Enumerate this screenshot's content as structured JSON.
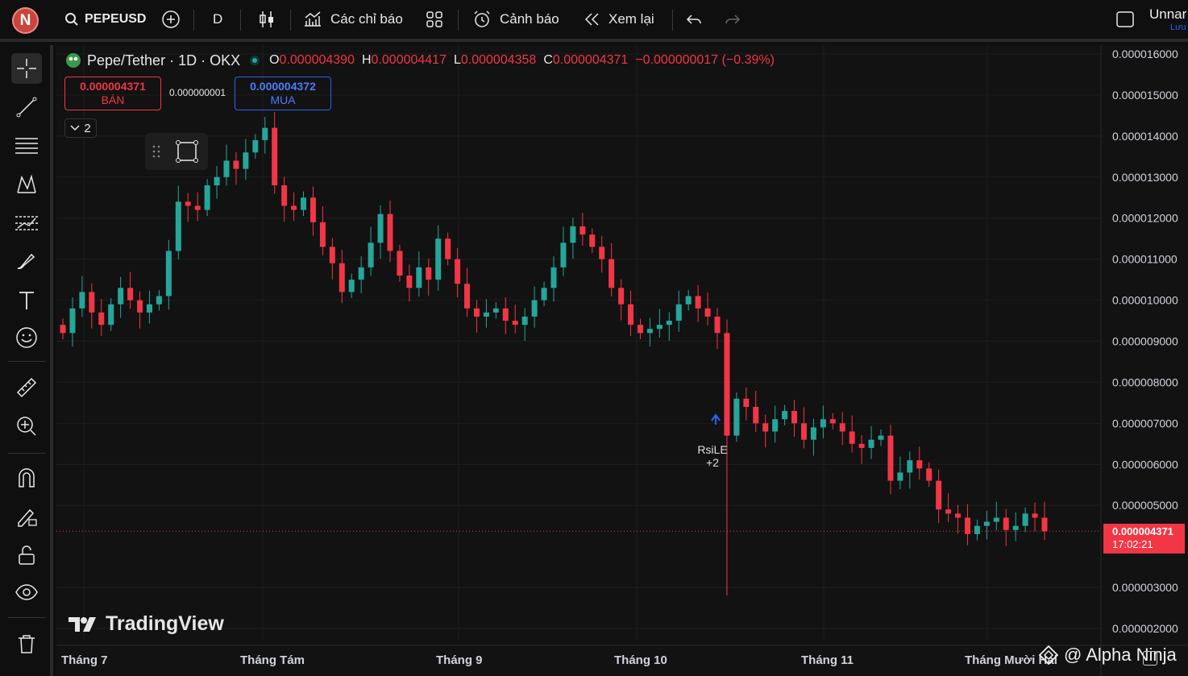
{
  "topbar": {
    "avatar_letter": "N",
    "symbol": "PEPEUSD",
    "interval": "D",
    "indicators_label": "Các chỉ báo",
    "alerts_label": "Cảnh báo",
    "replay_label": "Xem lại",
    "layout_name": "Unnar",
    "save_label": "Lưu"
  },
  "legend": {
    "title": "Pepe/Tether · 1D · OKX",
    "o_label": "O",
    "o_value": "0.000004390",
    "h_label": "H",
    "h_value": "0.000004417",
    "l_label": "L",
    "l_value": "0.000004358",
    "c_label": "C",
    "c_value": "0.000004371",
    "change": "−0.000000017 (−0.39%)",
    "sell_price": "0.000004371",
    "sell_label": "BÁN",
    "spread": "0.000000001",
    "buy_price": "0.000004372",
    "buy_label": "MUA",
    "collapse_count": "2"
  },
  "marker": {
    "label": "RsiLE",
    "extra": "+2"
  },
  "price_tag": {
    "price": "0.000004371",
    "countdown": "17:02:21"
  },
  "watermark": "TradingView",
  "credit": "@ Alpha Ninja",
  "colors": {
    "up": "#26a69a",
    "down": "#f23645",
    "bg": "#121212",
    "grid": "#1e1e1e",
    "buy": "#2962ff"
  },
  "chart_data": {
    "type": "candlestick",
    "y_ticks": [
      "0.000016000",
      "0.000015000",
      "0.000014000",
      "0.000013000",
      "0.000012000",
      "0.000011000",
      "0.000010000",
      "0.000009000",
      "0.000008000",
      "0.000007000",
      "0.000006000",
      "0.000005000",
      "0.000003000",
      "0.000002000"
    ],
    "x_ticks": [
      "Tháng 7",
      "Tháng Tám",
      "Tháng 9",
      "Tháng 10",
      "Tháng 11",
      "Tháng Mười Hai"
    ],
    "ylim": [
      2e-06,
      1.6e-05
    ],
    "closes_approx": [
      9.2,
      9.8,
      10.2,
      9.7,
      9.4,
      9.9,
      10.3,
      10.0,
      9.7,
      9.9,
      10.1,
      11.2,
      12.4,
      12.3,
      12.2,
      12.8,
      13.0,
      13.4,
      13.2,
      13.6,
      13.9,
      14.2,
      12.8,
      12.3,
      12.2,
      12.5,
      11.9,
      11.3,
      10.9,
      10.2,
      10.5,
      10.8,
      11.4,
      12.1,
      11.2,
      10.6,
      10.3,
      10.8,
      10.5,
      11.5,
      11.0,
      10.4,
      9.8,
      9.6,
      9.7,
      9.8,
      9.5,
      9.4,
      9.6,
      10.0,
      10.3,
      10.8,
      11.4,
      11.8,
      11.6,
      11.3,
      11.0,
      10.3,
      9.9,
      9.4,
      9.2,
      9.3,
      9.4,
      9.5,
      9.9,
      10.1,
      9.8,
      9.6,
      9.2,
      6.7,
      7.6,
      7.4,
      7.0,
      6.8,
      7.1,
      7.3,
      7.0,
      6.6,
      6.9,
      7.1,
      7.0,
      6.8,
      6.5,
      6.4,
      6.6,
      6.7,
      5.6,
      5.8,
      6.1,
      5.9,
      5.6,
      4.9,
      4.8,
      4.7,
      4.3,
      4.5,
      4.6,
      4.7,
      4.4,
      4.5,
      4.8,
      4.7,
      4.37
    ]
  }
}
